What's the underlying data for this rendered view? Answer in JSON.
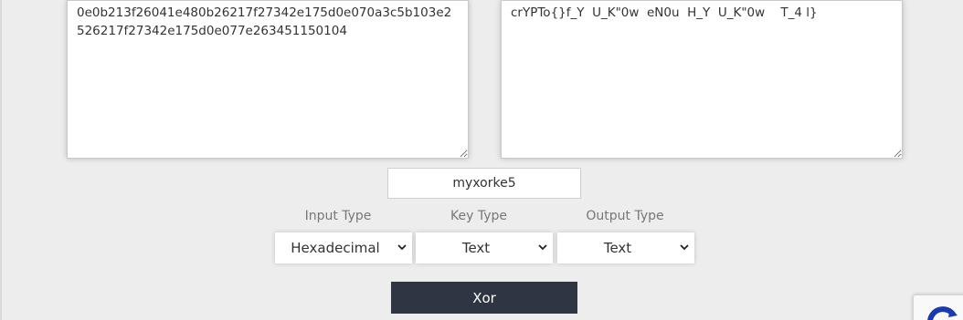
{
  "xor_tool": {
    "input_text": "0e0b213f26041e480b26217f27342e175d0e070a3c5b103e2526217f27342e175d0e077e263451150104",
    "output_text": "crYPTo{}f_Y  U_K\"0w  eN0u  H_Y  U_K\"0w    T_4 l}",
    "key_value": "myxorke5",
    "input_type_label": "Input Type",
    "key_type_label": "Key Type",
    "output_type_label": "Output Type",
    "input_type_value": "Hexadecimal",
    "key_type_value": "Text",
    "output_type_value": "Text",
    "xor_button_label": "Xor"
  },
  "colors": {
    "background": "#ededed",
    "button": "#2f3542",
    "recaptcha_blue": "#1c3aa9"
  },
  "icons": {
    "dropdown": "chevron-down-icon",
    "resize": "resize-grip-icon",
    "recaptcha": "recaptcha-icon"
  }
}
